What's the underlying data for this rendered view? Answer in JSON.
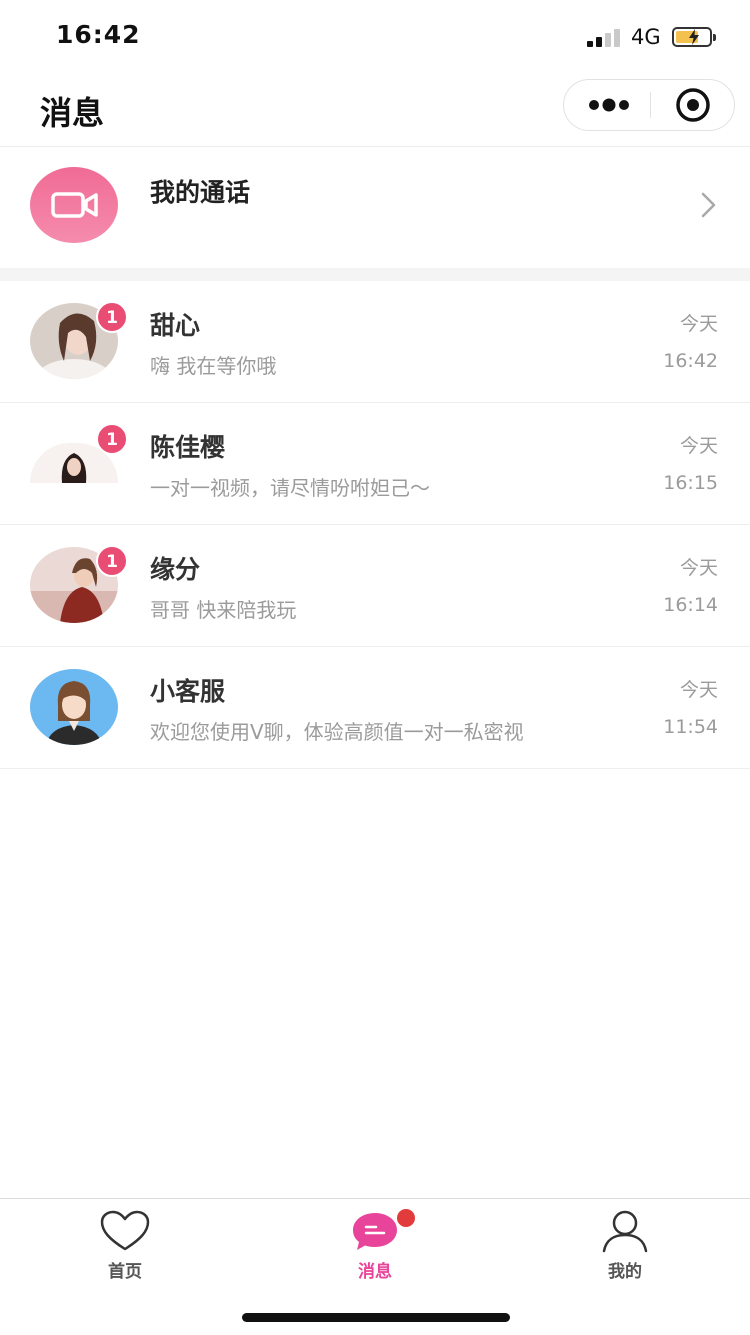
{
  "status_bar": {
    "time": "16:42",
    "network": "4G",
    "signal_bars": 2,
    "signal_bars_total": 4,
    "battery_charging": true
  },
  "header": {
    "title": "消息",
    "more_icon": "more-dots-icon",
    "close_icon": "target-close-icon"
  },
  "call_entry": {
    "label": "我的通话",
    "icon": "video-camera-icon",
    "accent_color": "#f06b95"
  },
  "messages": [
    {
      "name": "甜心",
      "preview": "嗨 我在等你哦",
      "date": "今天",
      "time": "16:42",
      "unread": "1"
    },
    {
      "name": "陈佳樱",
      "preview": "一对一视频，请尽情吩咐妲己～",
      "date": "今天",
      "time": "16:15",
      "unread": "1"
    },
    {
      "name": "缘分",
      "preview": "哥哥 快来陪我玩",
      "date": "今天",
      "time": "16:14",
      "unread": "1"
    },
    {
      "name": "小客服",
      "preview": "欢迎您使用V聊，体验高颜值一对一私密视",
      "date": "今天",
      "time": "11:54"
    }
  ],
  "tabs": [
    {
      "label": "首页",
      "icon": "heart-icon",
      "active": false
    },
    {
      "label": "消息",
      "icon": "chat-bubble-icon",
      "active": true,
      "has_dot": true
    },
    {
      "label": "我的",
      "icon": "person-icon",
      "active": false
    }
  ],
  "colors": {
    "active_tab": "#e8459a",
    "badge": "#ea4d74",
    "dot": "#e23b3b"
  }
}
